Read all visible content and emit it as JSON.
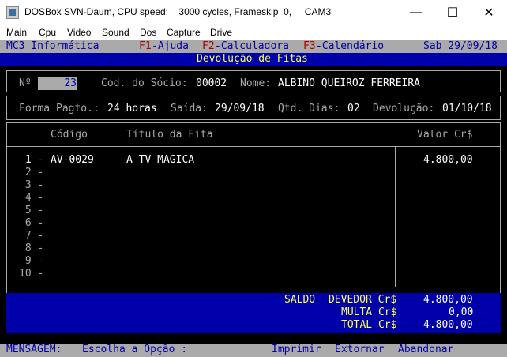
{
  "window": {
    "title": "DOSBox SVN-Daum, CPU speed:    3000 cycles, Frameskip  0,     CAM3",
    "minimize": "—",
    "maximize": "☐",
    "close": "✕"
  },
  "menu": [
    "Main",
    "Cpu",
    "Video",
    "Sound",
    "Dos",
    "Capture",
    "Drive"
  ],
  "app": {
    "company": "MC3 Informática",
    "f1_key": "F1",
    "f1_label": "-Ajuda",
    "f2_key": "F2",
    "f2_label": "-Calculadora",
    "f3_key": "F3",
    "f3_label": "-Calendário",
    "date": "Sab 29/09/18",
    "screen_title": "Devolução de Fitas"
  },
  "header": {
    "num_label": "Nº",
    "num_value": "23",
    "socio_label": "Cod. do Sócio:",
    "socio_value": "00002",
    "nome_label": "Nome:",
    "nome_value": "ALBINO QUEIROZ FERREIRA",
    "pagto_label": "Forma Pagto.:",
    "pagto_value": "24 horas",
    "saida_label": "Saída:",
    "saida_value": "29/09/18",
    "dias_label": "Qtd. Dias:",
    "dias_value": "02",
    "devolucao_label": "Devolução:",
    "devolucao_value": "01/10/18"
  },
  "table": {
    "col_codigo": "Código",
    "col_titulo": "Título da Fita",
    "col_valor": "Valor Cr$",
    "rows": [
      {
        "num": " 1 -",
        "codigo": "AV-0029",
        "titulo": "A TV MAGICA",
        "valor": "4.800,00"
      },
      {
        "num": " 2 -",
        "codigo": "",
        "titulo": "",
        "valor": ""
      },
      {
        "num": " 3 -",
        "codigo": "",
        "titulo": "",
        "valor": ""
      },
      {
        "num": " 4 -",
        "codigo": "",
        "titulo": "",
        "valor": ""
      },
      {
        "num": " 5 -",
        "codigo": "",
        "titulo": "",
        "valor": ""
      },
      {
        "num": " 6 -",
        "codigo": "",
        "titulo": "",
        "valor": ""
      },
      {
        "num": " 7 -",
        "codigo": "",
        "titulo": "",
        "valor": ""
      },
      {
        "num": " 8 -",
        "codigo": "",
        "titulo": "",
        "valor": ""
      },
      {
        "num": " 9 -",
        "codigo": "",
        "titulo": "",
        "valor": ""
      },
      {
        "num": "10 -",
        "codigo": "",
        "titulo": "",
        "valor": ""
      }
    ]
  },
  "totals": {
    "saldo_label": "SALDO",
    "devedor_label": "DEVEDOR Cr$",
    "devedor_value": "4.800,00",
    "multa_label": "MULTA Cr$",
    "multa_value": "0,00",
    "total_label": "TOTAL Cr$",
    "total_value": "4.800,00"
  },
  "statusbar": {
    "mensagem_label": "MENSAGEM:",
    "mensagem_text": "Escolha a Opção :",
    "opt_imprimir": "Imprimir",
    "opt_estornar": "Extornar",
    "opt_abandonar": "Abandonar"
  },
  "colors": {
    "dos_black": "#000000",
    "dos_grey": "#aaaaaa",
    "dos_blue": "#0000aa",
    "dos_red": "#aa0000",
    "dos_yellow": "#ffff55"
  }
}
